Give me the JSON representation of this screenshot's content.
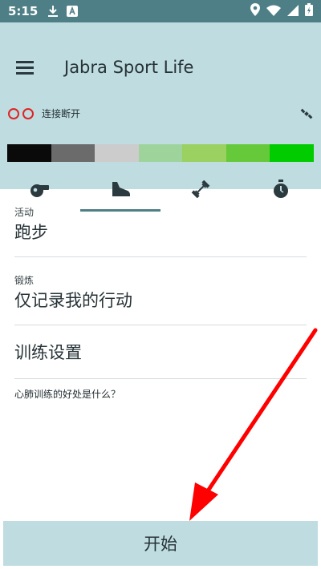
{
  "status_bar": {
    "time": "5:15"
  },
  "header": {
    "title": "Jabra Sport Life"
  },
  "connection": {
    "status": "连接断开"
  },
  "zones": {
    "colors": [
      "#0a0a0a",
      "#6b6b6b",
      "#cccccc",
      "#9ed49c",
      "#9ad160",
      "#66c93a",
      "#00cc00"
    ]
  },
  "tabs": [
    {
      "icon": "whistle-icon"
    },
    {
      "icon": "running-shoe-icon"
    },
    {
      "icon": "dumbbell-icon"
    },
    {
      "icon": "stopwatch-icon"
    }
  ],
  "list": {
    "activity": {
      "caption": "活动",
      "value": "跑步"
    },
    "workout": {
      "caption": "锻炼",
      "value": "仅记录我的行动"
    },
    "training_settings": {
      "value": "训练设置"
    },
    "benefit_link": "心肺训练的好处是什么？"
  },
  "start_button": {
    "label": "开始"
  },
  "annotation": {
    "arrow_color": "#ff0000"
  }
}
